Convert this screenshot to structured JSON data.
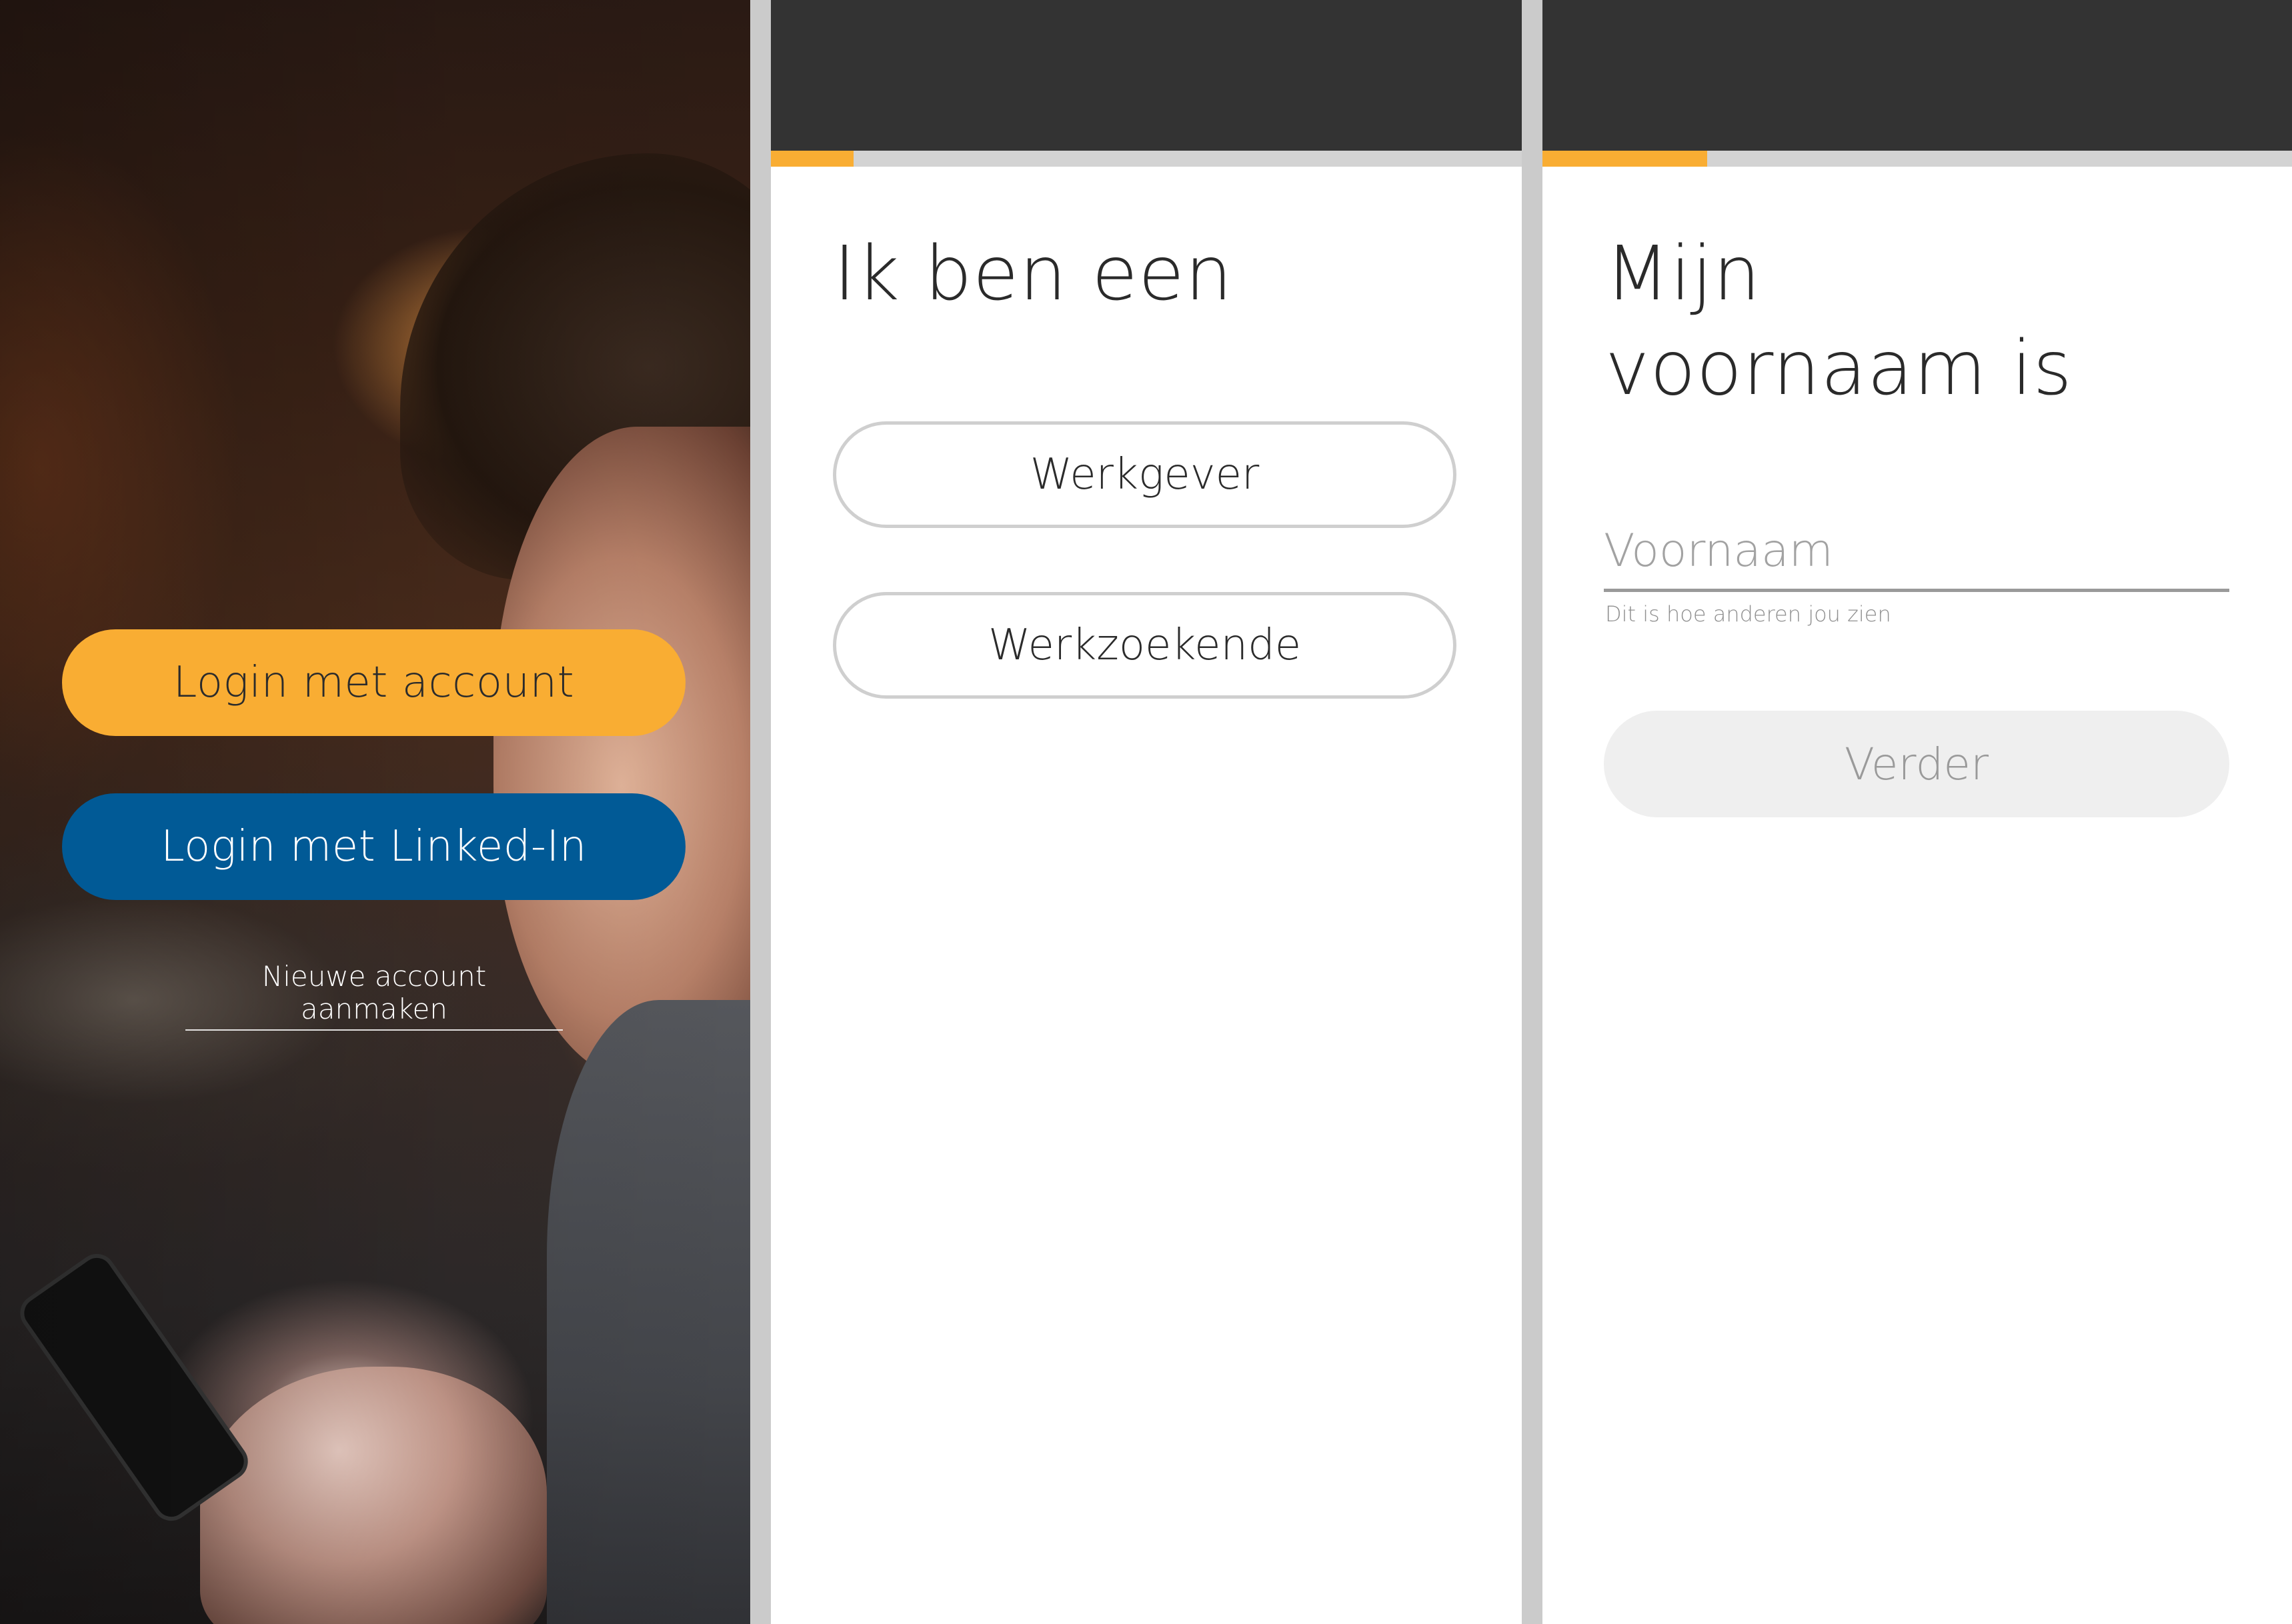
{
  "login_screen": {
    "login_account_label": "Login met account",
    "login_linkedin_label": "Login met Linked-In",
    "new_account_label": "Nieuwe account aanmaken"
  },
  "role_screen": {
    "heading": "Ik ben een",
    "options": [
      "Werkgever",
      "Werkzoekende"
    ],
    "progress_fraction": 0.11
  },
  "name_screen": {
    "heading_line1": "Mijn",
    "heading_line2": "voornaam is",
    "input_placeholder": "Voornaam",
    "input_value": "",
    "helper_text": "Dit is hoe anderen jou zien",
    "next_label": "Verder",
    "progress_fraction": 0.22
  },
  "colors": {
    "accent_orange": "#f9ad33",
    "linkedin_blue": "#015a96",
    "topbar": "#333333"
  },
  "icons": {
    "background_photo": "person-using-phone-photo"
  }
}
